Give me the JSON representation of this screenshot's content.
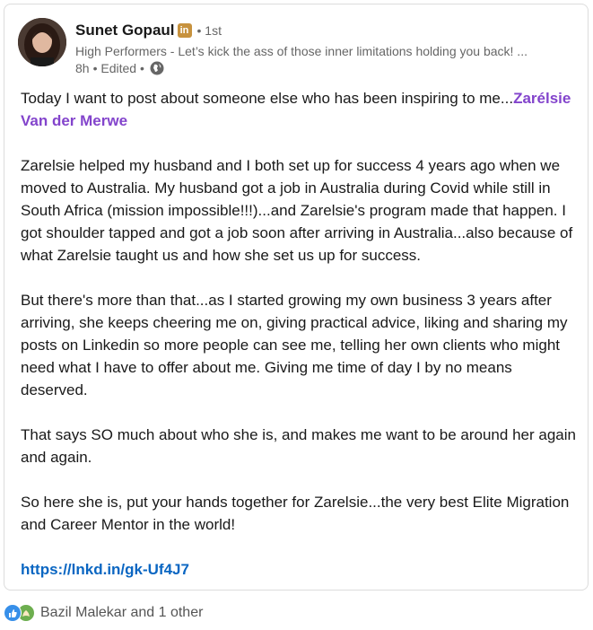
{
  "author": {
    "name": "Sunet Gopaul",
    "badge": "in",
    "degree": "• 1st",
    "headline": "High Performers - Let’s kick the ass of those inner limitations holding you back! ...",
    "time": "8h",
    "edited": "• Edited •"
  },
  "post": {
    "p1_text": "Today I want to post about someone else who has been inspiring to me...",
    "p1_mention": "Zarélsie Van der Merwe",
    "p2": "Zarelsie helped my husband and I both set up for success 4 years ago when we moved to Australia. My husband got a job in Australia during Covid while still in South Africa (mission impossible!!!)...and Zarelsie's program made that happen. I got shoulder tapped and got a job soon after arriving in Australia...also because of what Zarelsie taught us and how she set us up for success.",
    "p3": "But there's more than that...as I started growing my own business 3 years after arriving, she keeps cheering me on, giving practical advice, liking and sharing my posts on Linkedin so more people can see me, telling her own clients who might need what I have to offer about me. Giving me time of day I by no means deserved.",
    "p4": "That says SO much about who she is, and makes me want to be around her again and again.",
    "p5": "So here she is, put your hands together for Zarelsie...the very best Elite Migration and Career Mentor in the world!",
    "link": "https://lnkd.in/gk-Uf4J7"
  },
  "reactions": {
    "text": "Bazil Malekar and 1 other",
    "icons": [
      "like-icon",
      "celebrate-icon"
    ],
    "colors": {
      "like": "#378fe9",
      "celebrate": "#6dae4f"
    }
  },
  "colors": {
    "mention": "#8344cc",
    "link": "#0a66c2",
    "badge": "#c7923e"
  }
}
